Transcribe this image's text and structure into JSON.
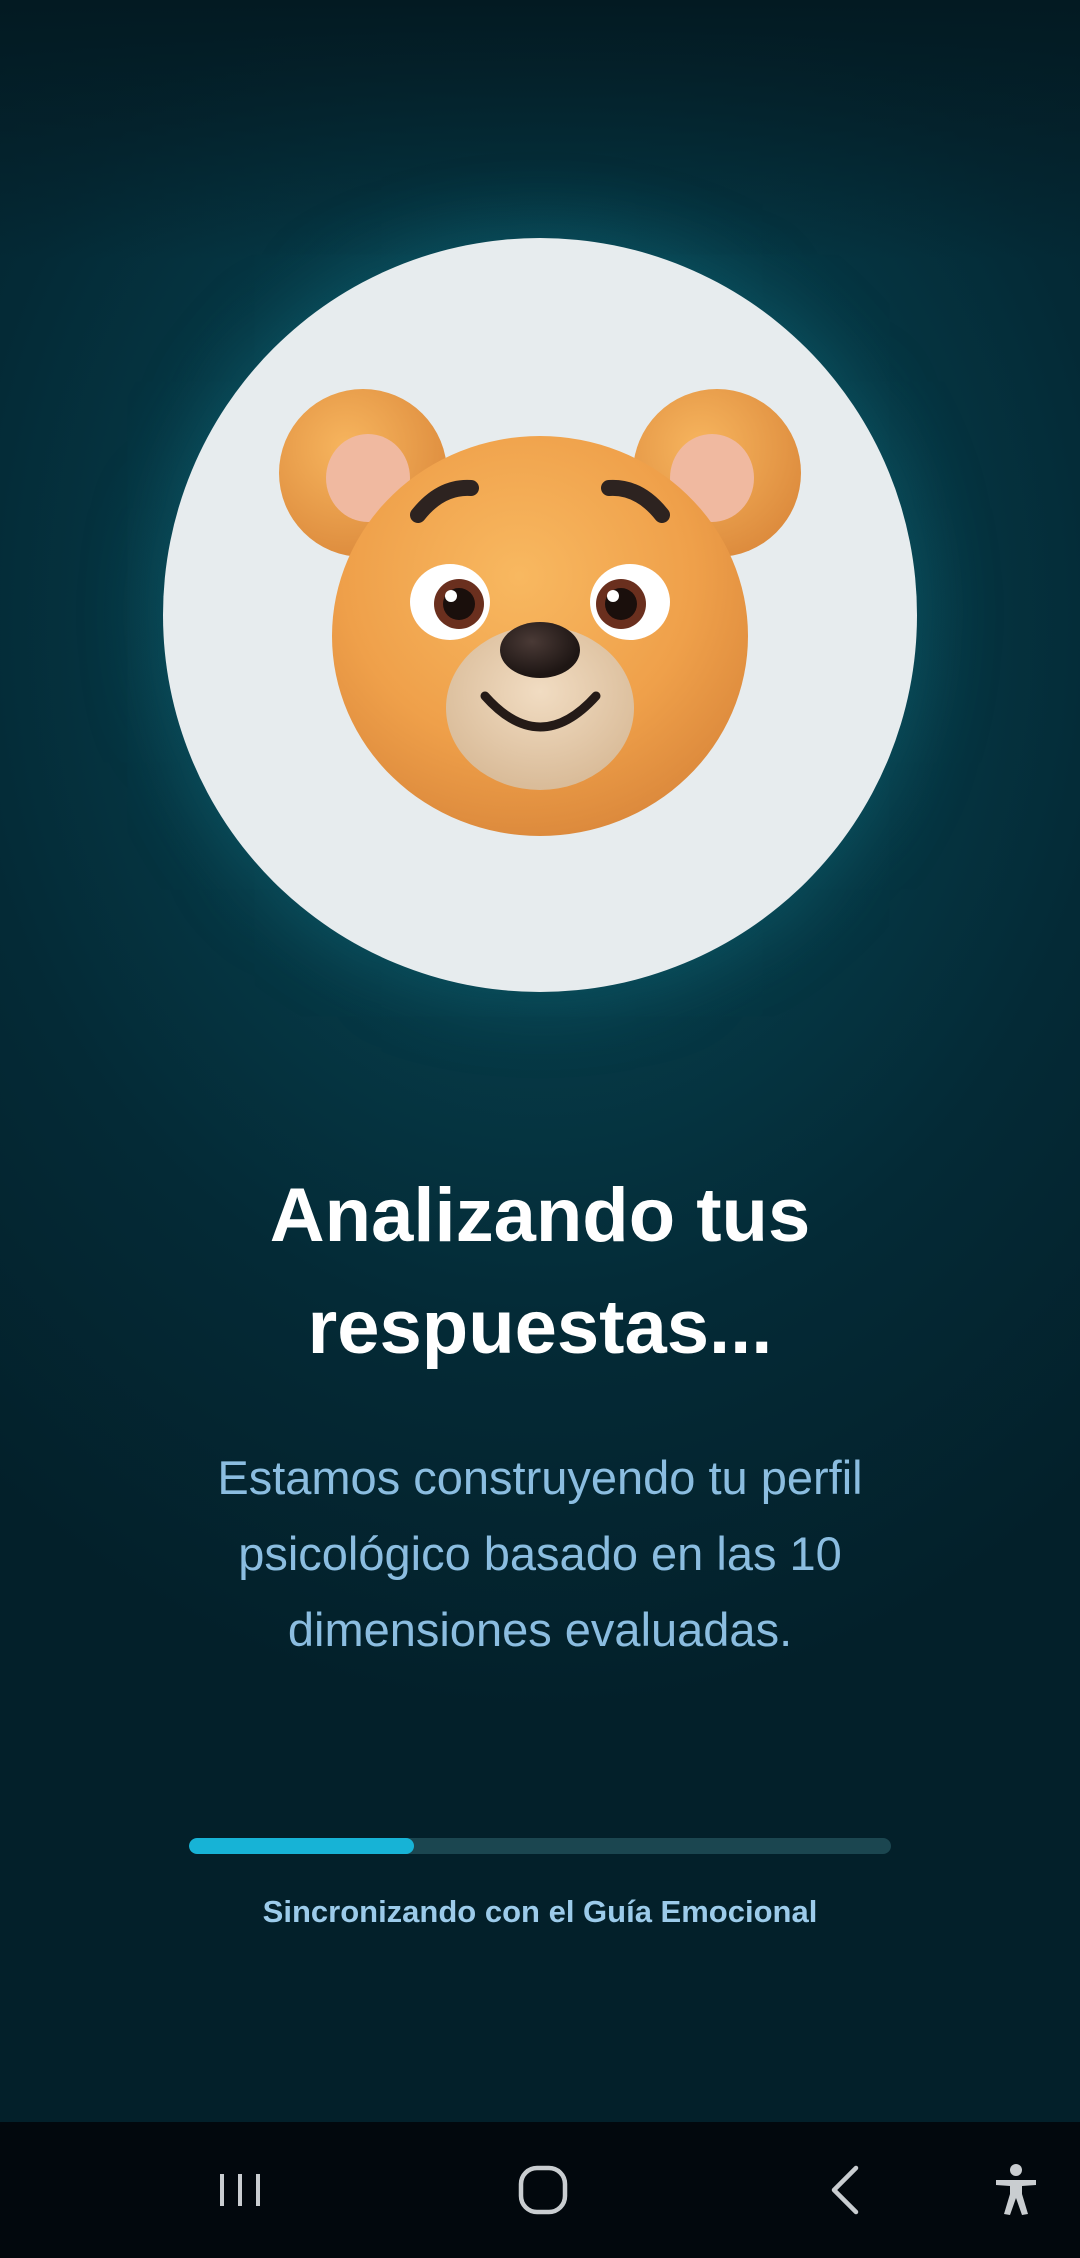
{
  "avatar": {
    "icon": "bear-face-icon"
  },
  "heading": {
    "title": "Analizando tus\nrespuestas...",
    "description": "Estamos construyendo tu perfil\npsicológico basado en las 10\ndimensiones evaluadas."
  },
  "progress": {
    "value_percent": 32,
    "label": "Sincronizando con el Guía Emocional",
    "fill_color": "#17b3d6",
    "track_color": "#1b4650"
  },
  "navbar": {
    "items": [
      {
        "icon": "recent-apps-icon"
      },
      {
        "icon": "home-icon"
      },
      {
        "icon": "back-icon"
      },
      {
        "icon": "accessibility-icon"
      }
    ]
  },
  "colors": {
    "background": "#063a47",
    "title": "#ffffff",
    "description": "#8bbde0"
  }
}
